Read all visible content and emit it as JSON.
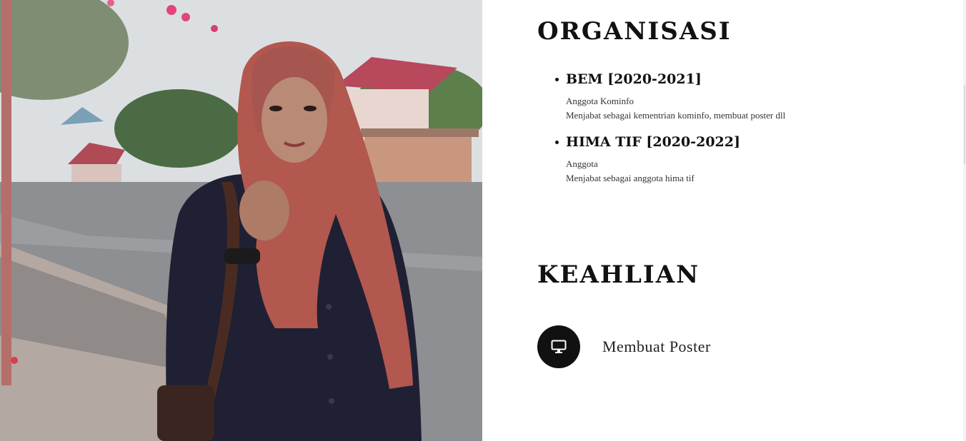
{
  "photo": {
    "alt": "profile-photo"
  },
  "organisasi": {
    "title": "ORGANISASI",
    "items": [
      {
        "name": "BEM [2020-2021]",
        "role": "Anggota Kominfo",
        "desc": "Menjabat sebagai kementrian kominfo, membuat poster dll"
      },
      {
        "name": "HIMA TIF [2020-2022]",
        "role": "Anggota",
        "desc": "Menjabat sebagai anggota hima tif"
      }
    ]
  },
  "keahlian": {
    "title": "KEAHLIAN",
    "skills": [
      {
        "label": "Membuat Poster",
        "icon": "monitor-icon"
      }
    ]
  },
  "colors": {
    "text": "#111111",
    "icon_bg": "#111111",
    "background": "#ffffff"
  }
}
